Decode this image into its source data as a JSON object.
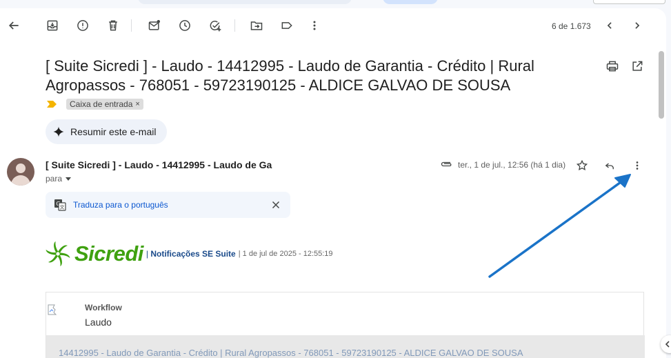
{
  "toolbar": {
    "pager_text": "6 de 1.673",
    "icons": [
      "back-icon",
      "archive-icon",
      "report-spam-icon",
      "delete-icon",
      "mark-unread-icon",
      "snooze-icon",
      "add-task-icon",
      "move-to-icon",
      "label-icon",
      "more-icon",
      "older-icon",
      "newer-icon"
    ]
  },
  "email": {
    "subject": "[ Suite Sicredi ] - Laudo - 14412995 - Laudo de Garantia - Crédito | Rural Agropassos - 768051 - 59723190125 - ALDICE GALVAO DE SOUSA",
    "label_chip": "Caixa de entrada",
    "label_chip_close": "×",
    "summarize_label": "Resumir este e-mail",
    "sender": "[ Suite Sicredi ] - Laudo - 14412995 - Laudo de Ga",
    "to_label": "para",
    "date": "ter., 1 de jul., 12:56 (há 1 dia)",
    "translate_link": "Traduza para o português"
  },
  "body": {
    "brand": "Sicredi",
    "notif_sep": "|",
    "notif_title": "Notificações SE Suite",
    "notif_date": "| 1 de jul de 2025 - 12:55:19",
    "workflow_title": "Workflow",
    "workflow_subtitle": "Laudo",
    "band_text": "14412995 - Laudo de Garantia - Crédito | Rural Agropassos - 768051 - 59723190125 - ALDICE GALVAO DE SOUSA"
  },
  "colors": {
    "annotation_arrow": "#1a73c8",
    "brand_green": "#3fa110",
    "link_blue": "#0b57d0",
    "notif_blue": "#1a4a8a"
  }
}
